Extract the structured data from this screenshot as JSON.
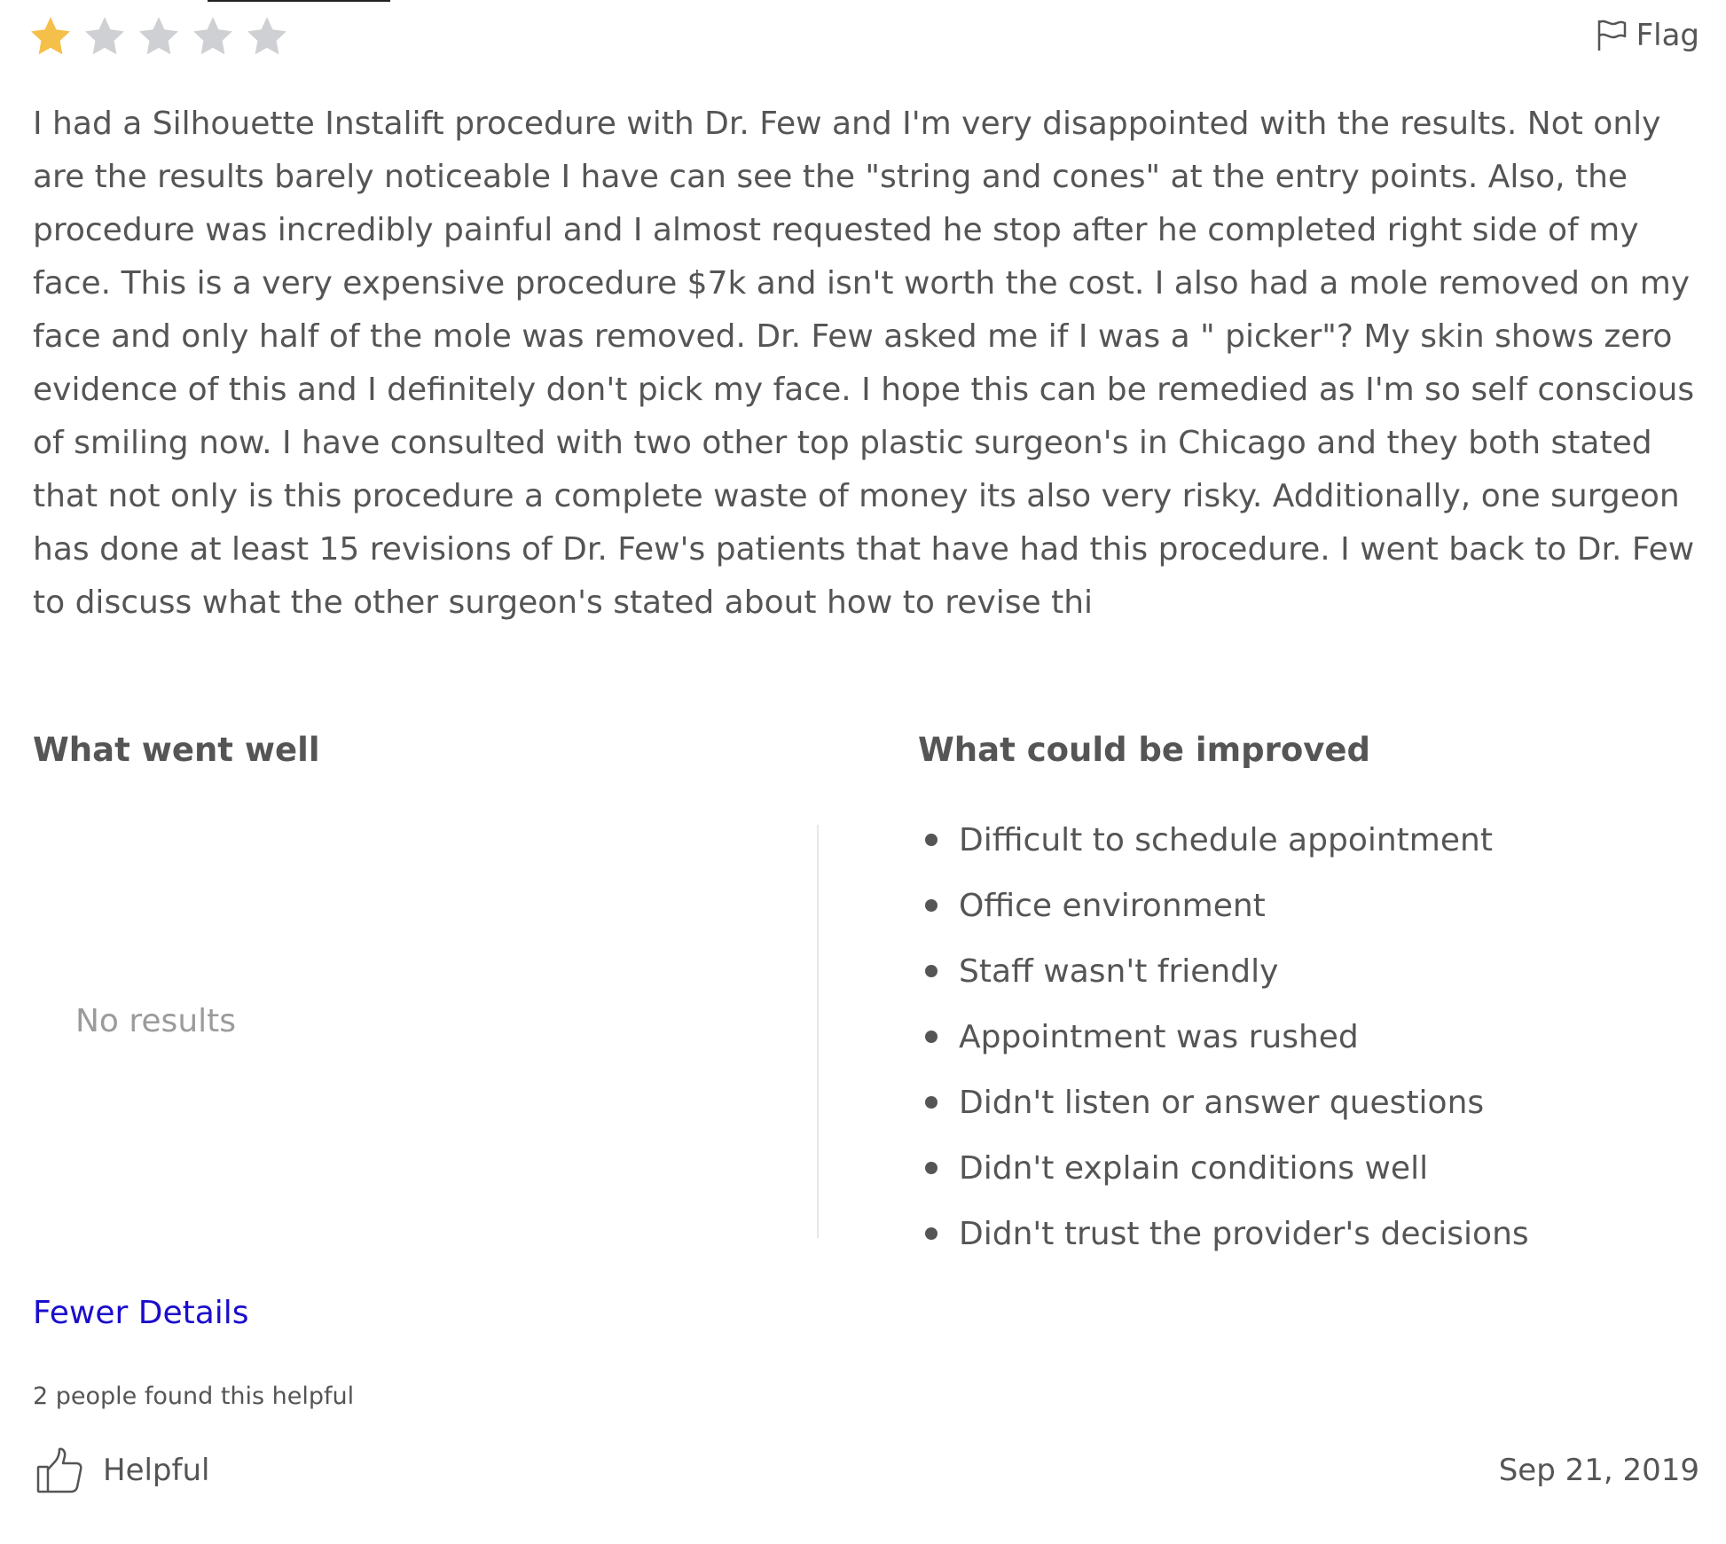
{
  "review": {
    "rating": 1,
    "max_rating": 5,
    "star_colors": {
      "filled": "#f5c04a",
      "empty": "#cfd0d3"
    },
    "flag_label": "Flag",
    "flag_icon": "flag-icon",
    "text": "I had a Silhouette Instalift procedure with Dr. Few and I'm very disappointed with the results. Not only are the results barely noticeable I have can see the \"string and cones\" at the entry points. Also, the procedure was incredibly painful and I almost requested he stop after he completed right side of my face. This is a very expensive procedure $7k and isn't worth the cost. I also had a mole removed on my face and only half of the mole was removed. Dr. Few asked me if I was a \" picker\"? My skin shows zero evidence of this and I definitely don't pick my face. I hope this can be remedied as I'm so self conscious of smiling now. I have consulted with two other top plastic surgeon's in Chicago and they both stated that not only is this procedure a complete waste of money its also very risky. Additionally, one surgeon has done at least 15 revisions of Dr. Few's patients that have had this procedure. I went back to Dr. Few to discuss what the other surgeon's stated about how to revise thi",
    "went_well": {
      "heading": "What went well",
      "empty_text": "No results"
    },
    "could_improve": {
      "heading": "What could be improved",
      "items": [
        "Difficult to schedule appointment",
        "Office environment",
        "Staff wasn't friendly",
        "Appointment was rushed",
        "Didn't listen or answer questions",
        "Didn't explain conditions well",
        "Didn't trust the provider's decisions"
      ]
    },
    "fewer_details_label": "Fewer Details",
    "link_color": "#1a0dcc",
    "helpful_count_text": "2 people found this helpful",
    "helpful_label": "Helpful",
    "helpful_icon": "thumbs-up-icon",
    "date": "Sep 21, 2019"
  }
}
